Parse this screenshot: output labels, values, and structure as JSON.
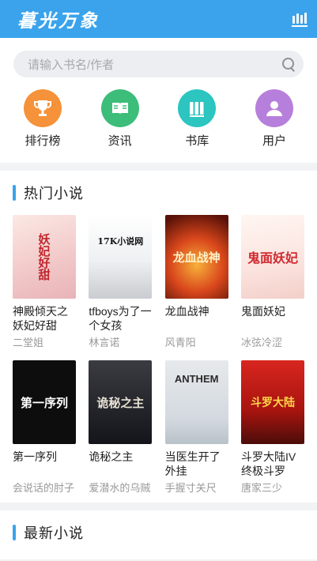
{
  "header": {
    "logo": "暮光万象",
    "shelf_icon": "bookshelf-icon"
  },
  "search": {
    "placeholder": "请输入书名/作者",
    "icon": "search-icon"
  },
  "nav": [
    {
      "label": "排行榜",
      "icon": "trophy-icon",
      "color": "#f5923a"
    },
    {
      "label": "资讯",
      "icon": "news-icon",
      "color": "#3cbd7a"
    },
    {
      "label": "书库",
      "icon": "books-icon",
      "color": "#2cc5c0"
    },
    {
      "label": "用户",
      "icon": "user-icon",
      "color": "#b77fdc"
    }
  ],
  "hot": {
    "title": "热门小说",
    "books": [
      {
        "title": "神殿倾天之妖妃好甜",
        "author": "二堂姐",
        "cover_text": "妖妃好甜"
      },
      {
        "title": "tfboys为了一个女孩",
        "author": "林言诺",
        "cover_text": "17K小说网"
      },
      {
        "title": "龙血战神",
        "author": "风青阳",
        "cover_text": "龙血战神"
      },
      {
        "title": "鬼面妖妃",
        "author": "冰弦冷涩",
        "cover_text": "鬼面妖妃"
      },
      {
        "title": "第一序列",
        "author": "会说话的肘子",
        "cover_text": "第一序列"
      },
      {
        "title": "诡秘之主",
        "author": "爱潜水的乌贼",
        "cover_text": "诡秘之主"
      },
      {
        "title": "当医生开了外挂",
        "author": "手握寸关尺",
        "cover_text": "ANTHEM"
      },
      {
        "title": "斗罗大陆IV终极斗罗",
        "author": "唐家三少",
        "cover_text": "斗罗大陆"
      }
    ]
  },
  "latest": {
    "title": "最新小说"
  }
}
